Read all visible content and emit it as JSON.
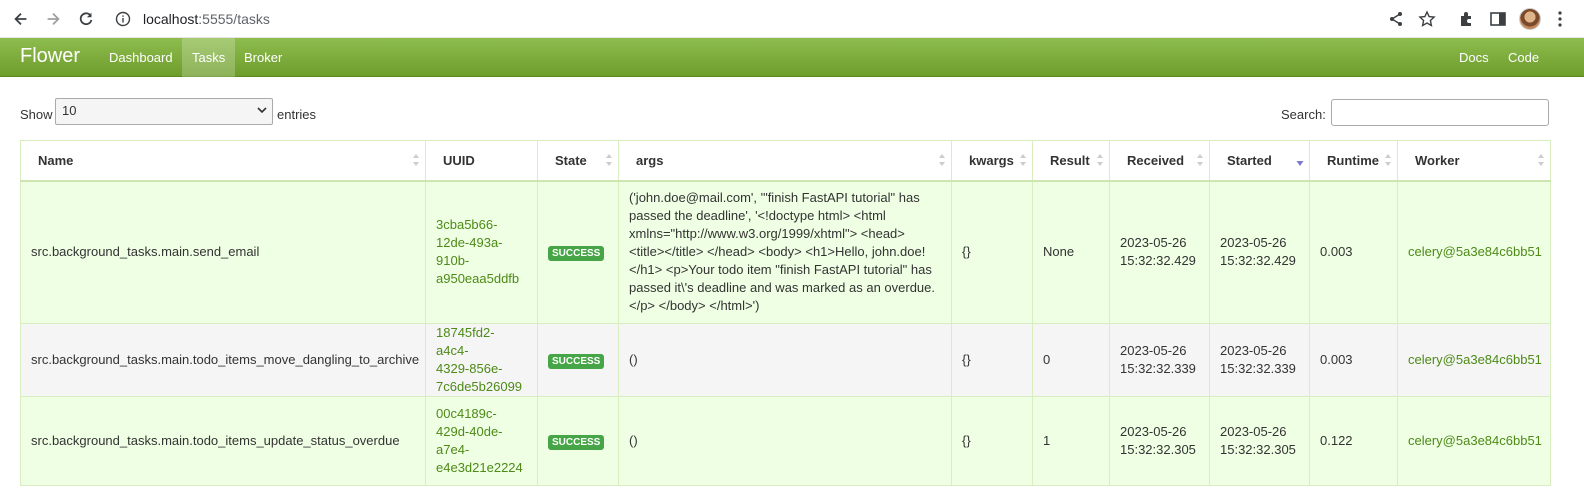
{
  "browser": {
    "url_host": "localhost",
    "url_rest": ":5555/tasks"
  },
  "navbar": {
    "brand": "Flower",
    "links": [
      {
        "label": "Dashboard",
        "active": false
      },
      {
        "label": "Tasks",
        "active": true
      },
      {
        "label": "Broker",
        "active": false
      }
    ],
    "right_links": [
      {
        "label": "Docs"
      },
      {
        "label": "Code"
      }
    ]
  },
  "controls": {
    "show_label": "Show",
    "entries_value": "10",
    "entries_label": "entries",
    "search_label": "Search:"
  },
  "table": {
    "headers": [
      "Name",
      "UUID",
      "State",
      "args",
      "kwargs",
      "Result",
      "Received",
      "Started",
      "Runtime",
      "Worker"
    ],
    "rows": [
      {
        "name": "src.background_tasks.main.send_email",
        "uuid": [
          "3cba5b66-",
          "12de-493a-",
          "910b-",
          "a950eaa5ddfb"
        ],
        "state": "SUCCESS",
        "args": [
          "('john.doe@mail.com', '\"finish FastAPI tutorial\" has",
          "passed the deadline', '<!doctype html> <html",
          "xmlns=\"http://www.w3.org/1999/xhtml\"> <head>",
          "<title></title> </head> <body> <h1>Hello, john.doe!",
          "</h1> <p>Your todo item \"finish FastAPI tutorial\" has",
          "passed it\\'s deadline and was marked as an overdue.",
          "</p> </body> </html>')"
        ],
        "kwargs": "{}",
        "result": "None",
        "received": [
          "2023-05-26",
          "15:32:32.429"
        ],
        "started": [
          "2023-05-26",
          "15:32:32.429"
        ],
        "runtime": "0.003",
        "worker": "celery@5a3e84c6bb51"
      },
      {
        "name": "src.background_tasks.main.todo_items_move_dangling_to_archive",
        "uuid": [
          "18745fd2-a4c4-",
          "4329-856e-",
          "7c6de5b26099"
        ],
        "state": "SUCCESS",
        "args": [
          "()"
        ],
        "kwargs": "{}",
        "result": "0",
        "received": [
          "2023-05-26",
          "15:32:32.339"
        ],
        "started": [
          "2023-05-26",
          "15:32:32.339"
        ],
        "runtime": "0.003",
        "worker": "celery@5a3e84c6bb51"
      },
      {
        "name": "src.background_tasks.main.todo_items_update_status_overdue",
        "uuid": [
          "00c4189c-",
          "429d-40de-",
          "a7e4-",
          "e4e3d21e2224"
        ],
        "state": "SUCCESS",
        "args": [
          "()"
        ],
        "kwargs": "{}",
        "result": "1",
        "received": [
          "2023-05-26",
          "15:32:32.305"
        ],
        "started": [
          "2023-05-26",
          "15:32:32.305"
        ],
        "runtime": "0.122",
        "worker": "celery@5a3e84c6bb51"
      }
    ]
  },
  "colors": {
    "navbar": "#7aab3a",
    "link": "#4d8a17",
    "success": "#46a546",
    "row_alt": "#efffe4"
  }
}
